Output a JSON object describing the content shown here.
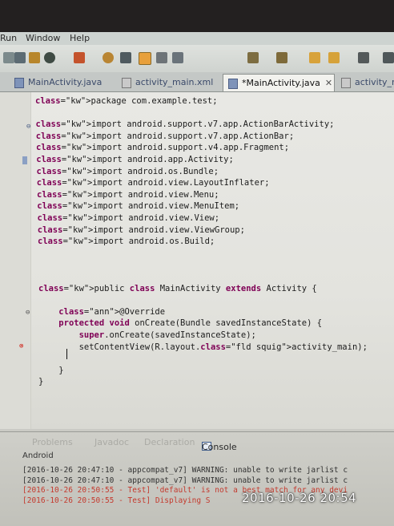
{
  "menu": [
    "Run",
    "Window",
    "Help"
  ],
  "tabs": [
    {
      "label": "MainActivity.java",
      "active": false
    },
    {
      "label": "activity_main.xml",
      "active": false
    },
    {
      "label": "*MainActivity.java",
      "active": true,
      "close": "✕"
    },
    {
      "label": "activity_m",
      "active": false
    }
  ],
  "code_lines": [
    "package com.example.test;",
    "",
    "import android.support.v7.app.ActionBarActivity;",
    "import android.support.v7.app.ActionBar;",
    "import android.support.v4.app.Fragment;",
    "import android.app.Activity;",
    "import android.os.Bundle;",
    "import android.view.LayoutInflater;",
    "import android.view.Menu;",
    "import android.view.MenuItem;",
    "import android.view.View;",
    "import android.view.ViewGroup;",
    "import android.os.Build;",
    "",
    "",
    "",
    "public class MainActivity extends Activity {",
    "",
    "    @Override",
    "    protected void onCreate(Bundle savedInstanceState) {",
    "        super.onCreate(savedInstanceState);",
    "        setContentView(R.layout.activity_main);",
    "",
    "    }",
    "}"
  ],
  "console": {
    "tabs": [
      "Problems",
      "Javadoc",
      "Declaration",
      "Console"
    ],
    "title": "Android",
    "lines": [
      {
        "text": "[2016-10-26 20:47:10 - appcompat_v7] WARNING: unable to write jarlist c",
        "color": "#333333"
      },
      {
        "text": "[2016-10-26 20:47:10 - appcompat_v7] WARNING: unable to write jarlist c",
        "color": "#333333"
      },
      {
        "text": "[2016-10-26 20:50:55 - Test] 'default' is not a best match for any devi",
        "color": "#c43a2e"
      },
      {
        "text": "[2016-10-26 20:50:55 - Test] Displaying S",
        "color": "#c43a2e"
      }
    ]
  },
  "photo_timestamp": "2016-10-26  20:54"
}
